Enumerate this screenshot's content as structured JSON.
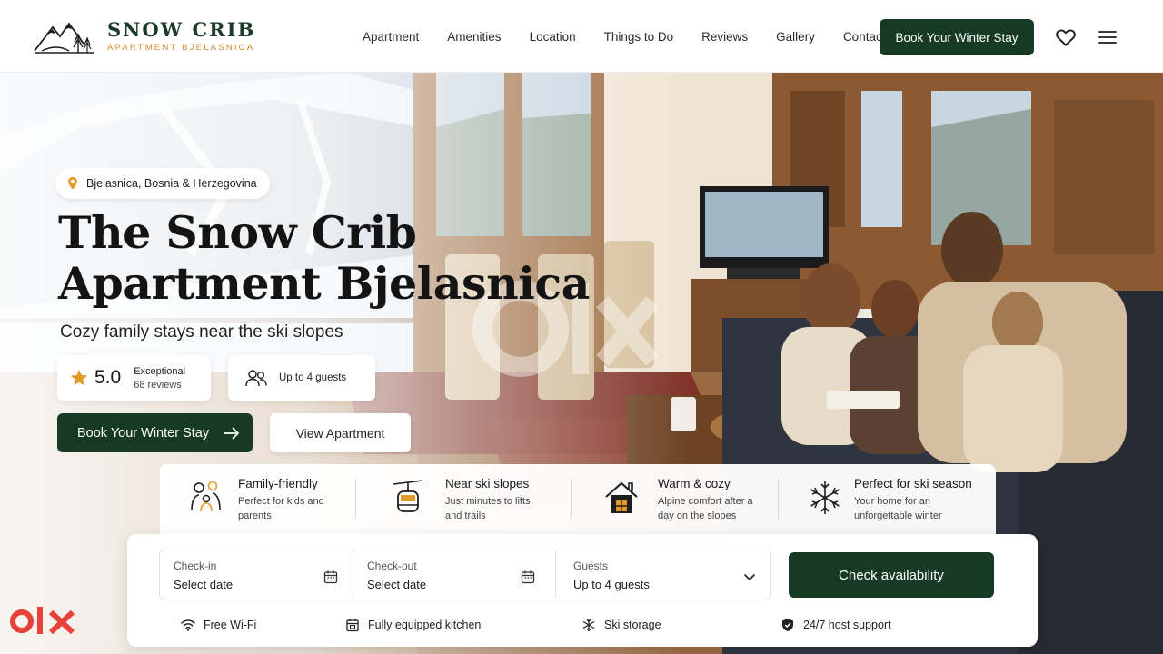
{
  "brand": {
    "title": "SNOW CRIB",
    "subtitle": "APARTMENT BJELASNICA"
  },
  "nav": {
    "items": [
      "Apartment",
      "Amenities",
      "Location",
      "Things to Do",
      "Reviews",
      "Gallery",
      "Contact"
    ],
    "cta_label": "Book Your Winter Stay",
    "favorite_icon": "heart-icon",
    "menu_icon": "hamburger-icon"
  },
  "hero": {
    "location": "Bjelasnica, Bosnia & Herzegovina",
    "title_line1": "The Snow Crib",
    "title_line2": "Apartment Bjelasnica",
    "subtitle": "Cozy family stays near the ski slopes",
    "rating_score": "5.0",
    "rating_label": "Exceptional",
    "rating_reviews": "68 reviews",
    "guests_label": "Up to 4 guests",
    "primary_button": "Book Your Winter Stay",
    "secondary_button": "View Apartment"
  },
  "features": [
    {
      "title": "Family-friendly",
      "desc": "Perfect for kids and parents",
      "icon": "family-icon"
    },
    {
      "title": "Near ski slopes",
      "desc": "Just minutes to lifts and trails",
      "icon": "cable-car-icon"
    },
    {
      "title": "Warm & cozy",
      "desc": "Alpine comfort after a day on the slopes",
      "icon": "cabin-icon"
    },
    {
      "title": "Perfect for ski season",
      "desc": "Your home for an unforgettable winter",
      "icon": "snowflake-icon"
    }
  ],
  "booking": {
    "checkin_label": "Check-in",
    "checkin_value": "Select date",
    "checkout_label": "Check-out",
    "checkout_value": "Select date",
    "guests_label": "Guests",
    "guests_value": "Up to 4 guests",
    "submit_label": "Check availability"
  },
  "amenities": [
    {
      "label": "Free Wi-Fi",
      "icon": "wifi-icon"
    },
    {
      "label": "Fully equipped kitchen",
      "icon": "kitchen-icon"
    },
    {
      "label": "Ski storage",
      "icon": "snowflake-icon"
    },
    {
      "label": "24/7 host support",
      "icon": "shield-icon"
    }
  ],
  "colors": {
    "primary": "#163a24",
    "accent": "#d9892f",
    "star": "#e29a2c",
    "watermark": "#e8413a"
  }
}
